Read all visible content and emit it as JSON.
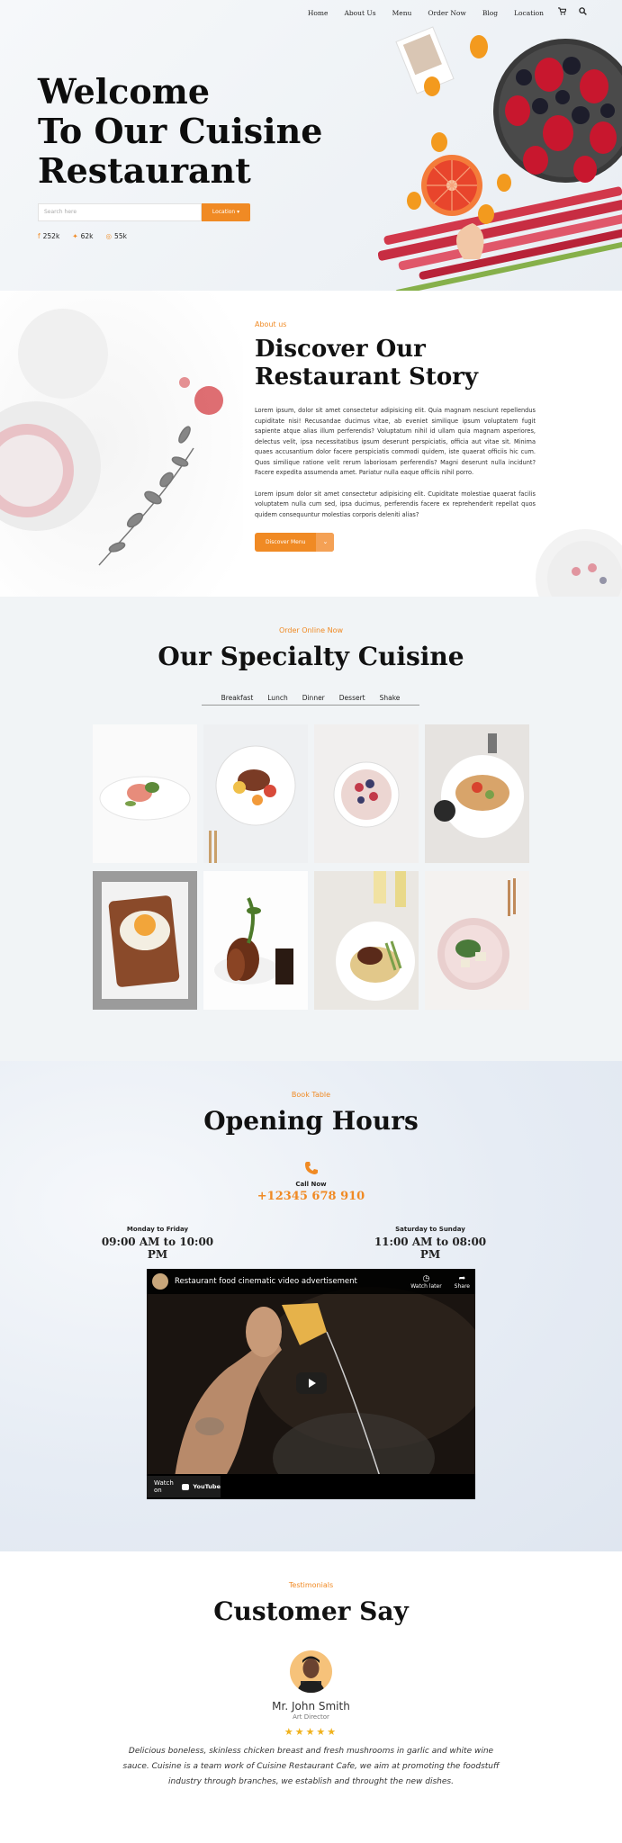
{
  "nav": {
    "items": [
      "Home",
      "About Us",
      "Menu",
      "Order Now",
      "Blog",
      "Location"
    ],
    "cart_icon": "cart-icon",
    "search_icon": "search-icon"
  },
  "hero": {
    "title_line1": "Welcome",
    "title_line2": "To Our Cuisine",
    "title_line3": "Restaurant",
    "search_placeholder": "Search here",
    "location_button": "Location ▾",
    "social": [
      {
        "icon": "facebook-icon",
        "count": "252k"
      },
      {
        "icon": "twitter-icon",
        "count": "62k"
      },
      {
        "icon": "instagram-icon",
        "count": "55k"
      }
    ]
  },
  "about": {
    "label": "About us",
    "heading_line1": "Discover Our",
    "heading_line2": "Restaurant Story",
    "para1": "Lorem ipsum, dolor sit amet consectetur adipisicing elit. Quia magnam nesciunt repellendus cupiditate nisi! Recusandae ducimus vitae, ab eveniet similique ipsum voluptatem fugit sapiente atque alias illum perferendis? Voluptatum nihil id ullam quia magnam asperiores, delectus velit, ipsa necessitatibus ipsum deserunt perspiciatis, officia aut vitae sit. Minima quaes accusantium dolor facere perspiciatis commodi quidem, iste quaerat officiis hic cum. Quos similique ratione velit rerum laboriosam perferendis? Magni deserunt nulla incidunt? Facere expedita assumenda amet. Pariatur nulla eaque officiis nihil porro.",
    "para2": "Lorem ipsum dolor sit amet consectetur adipisicing elit. Cupiditate molestiae quaerat facilis voluptatem nulla cum sed, ipsa ducimus, perferendis facere ex reprehenderit repellat quos quidem consequuntur molestias corporis deleniti alias?",
    "button": "Discover Menu"
  },
  "specialty": {
    "label": "Order Online Now",
    "heading": "Our Specialty Cuisine",
    "tabs": [
      "Breakfast",
      "Lunch",
      "Dinner",
      "Dessert",
      "Shake"
    ]
  },
  "hours": {
    "label": "Book Table",
    "heading": "Opening Hours",
    "call_label": "Call Now",
    "phone": "+12345 678 910",
    "weekday_label": "Monday to Friday",
    "weekday_hours": "09:00 AM to 10:00 PM",
    "weekend_label": "Saturday to Sunday",
    "weekend_hours": "11:00 AM to 08:00 PM",
    "video_title": "Restaurant food cinematic video advertisement",
    "watch_later": "Watch later",
    "share": "Share",
    "watch_on": "Watch on",
    "youtube": "YouTube"
  },
  "testimonials": {
    "label": "Testimonials",
    "heading": "Customer Say",
    "name": "Mr. John Smith",
    "role": "Art Director",
    "stars": "★★★★★",
    "quote": "Delicious boneless, skinless chicken breast and fresh mushrooms in garlic and white wine sauce. Cuisine is a team work of Cuisine Restaurant Cafe, we aim at promoting the foodstuff industry through branches, we establish and throught the new dishes."
  },
  "colors": {
    "accent": "#f08a24",
    "star": "#f0b21d"
  }
}
